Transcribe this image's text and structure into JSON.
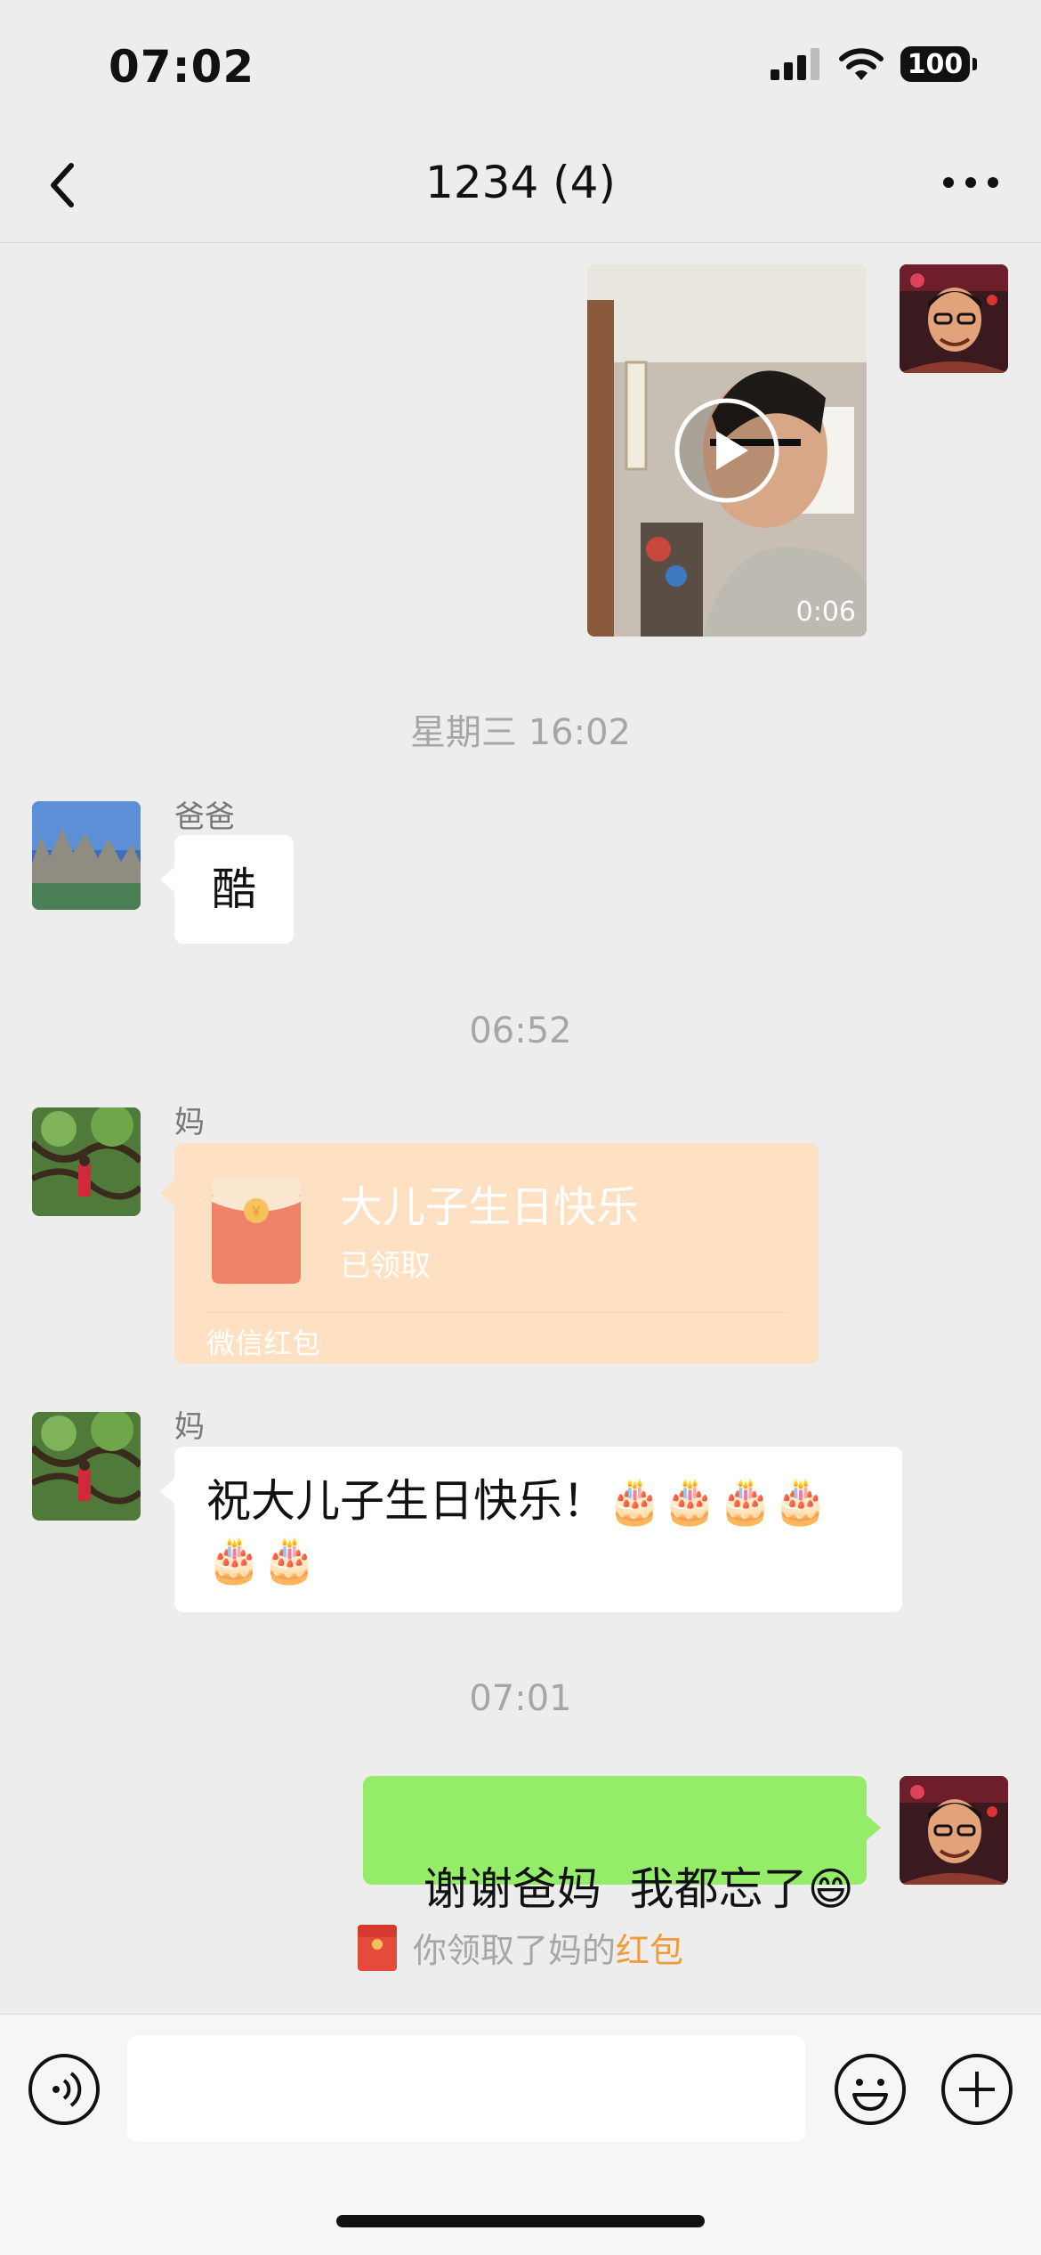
{
  "status_bar": {
    "time": "07:02",
    "battery": "100"
  },
  "nav": {
    "title": "1234 (4)"
  },
  "messages": {
    "video": {
      "duration": "0:06"
    },
    "ts1": "星期三 16:02",
    "dad": {
      "name": "爸爸",
      "text": "酷"
    },
    "ts2": "06:52",
    "redpacket": {
      "sender": "妈",
      "title": "大儿子生日快乐",
      "status": "已领取",
      "footer": "微信红包"
    },
    "mom_text": {
      "sender": "妈",
      "text": "祝大儿子生日快乐！🎂🎂🎂🎂🎂🎂"
    },
    "ts3": "07:01",
    "my_reply": {
      "text": "谢谢爸妈  我都忘了😄"
    },
    "system_note": {
      "prefix": "你领取了妈的",
      "link": "红包"
    }
  },
  "colors": {
    "accent_green": "#95ec69",
    "red_packet": "#fde1c2",
    "link_orange": "#f29b38"
  }
}
